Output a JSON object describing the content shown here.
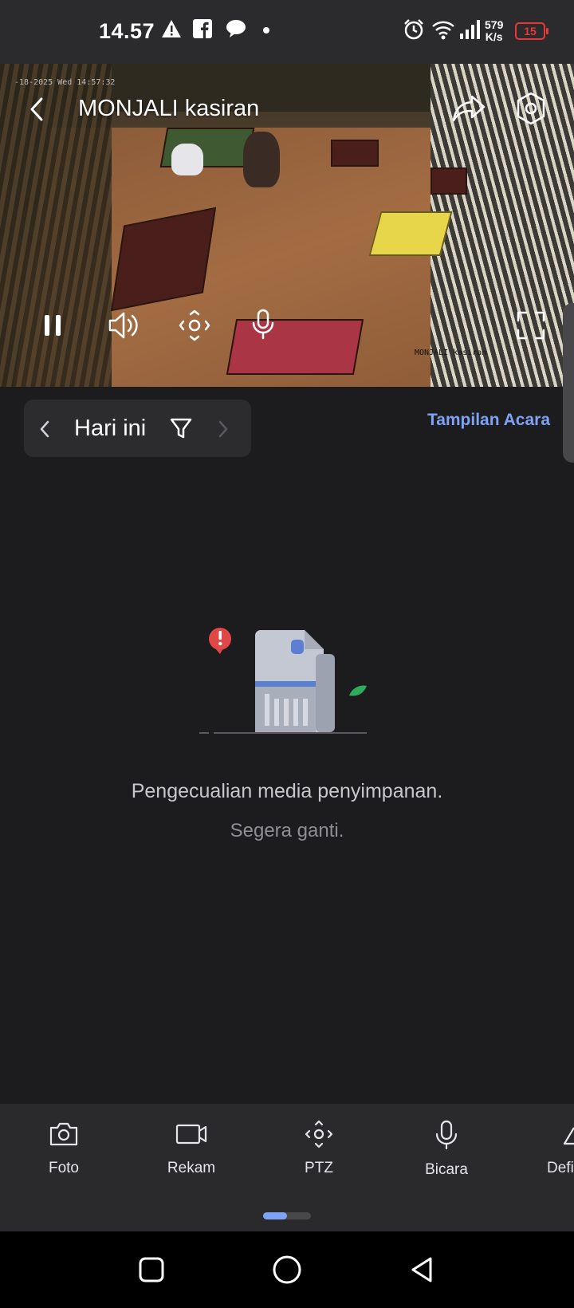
{
  "status_bar": {
    "time": "14.57",
    "net_speed_value": "579",
    "net_speed_unit": "K/s",
    "battery": "15",
    "icons": [
      "warning-icon",
      "facebook-icon",
      "chat-icon",
      "dot-icon",
      "alarm-icon",
      "wifi-icon",
      "signal-icon",
      "battery-icon"
    ]
  },
  "video": {
    "title": "MONJALI kasiran",
    "timestamp_overlay": "-18-2025 Wed 14:57:32",
    "camera_label_overlay": "MONJALI kasiran",
    "controls": [
      "pause-icon",
      "volume-icon",
      "ptz-icon",
      "mic-icon",
      "fullscreen-icon"
    ],
    "header_actions": [
      "back-icon",
      "share-icon",
      "settings-icon"
    ]
  },
  "timeline": {
    "date_label": "Hari ini",
    "event_view_link": "Tampilan Acara"
  },
  "empty_state": {
    "message": "Pengecualian media penyimpanan.",
    "sub_message": "Segera ganti."
  },
  "toolbar": {
    "items": [
      {
        "label": "Foto",
        "icon": "camera-icon"
      },
      {
        "label": "Rekam",
        "icon": "video-record-icon"
      },
      {
        "label": "PTZ",
        "icon": "ptz-icon"
      },
      {
        "label": "Bicara",
        "icon": "mic-icon"
      },
      {
        "label": "Defi",
        "icon": "definition-icon"
      }
    ]
  },
  "colors": {
    "background": "#1c1c1e",
    "accent": "#7ea3f5",
    "battery_low": "#e53935"
  }
}
